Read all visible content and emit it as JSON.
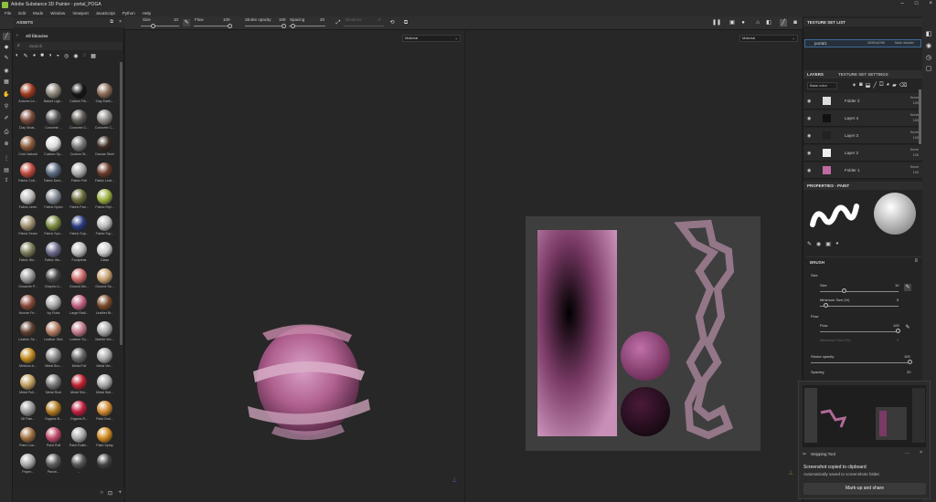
{
  "window": {
    "title": "Adobe Substance 3D Painter - portal_POGA"
  },
  "menu": [
    "File",
    "Edit",
    "Mode",
    "Window",
    "Viewport",
    "JavaScript",
    "Python",
    "Help"
  ],
  "toolbar": {
    "size_label": "Size",
    "size_value": "10",
    "flow_label": "Flow",
    "flow_value": "100",
    "stroke_label": "Stroke opacity",
    "stroke_value": "100",
    "spacing_label": "Spacing",
    "spacing_value": "20",
    "distance_label": "Distance",
    "distance_value": "0"
  },
  "assets": {
    "title": "ASSETS",
    "library": "All libraries",
    "search_placeholder": "Search",
    "items": [
      "Autumn Le...",
      "Baked Ligh...",
      "Carbon Fib...",
      "Clay Earth...",
      "Clay Smal...",
      "Concrete ...",
      "Concrete C...",
      "Concrete C...",
      "Cork Natural",
      "Custom Sp...",
      "Custom St...",
      "Damas Steel",
      "Fabric Cott...",
      "Fabric Deni...",
      "Fabric Felt",
      "Fabric Leat...",
      "Fabric Linen",
      "Fabric Nylon",
      "Fabric Pan...",
      "Fabric Ripl...",
      "Fabric Seam",
      "Fabric Spo...",
      "Fabric Sup...",
      "Fabric Top...",
      "Fabric Wo...",
      "Fabric Wo...",
      "Footprints",
      "Glass",
      "Gouache P...",
      "Graphic Li...",
      "Ground Mo...",
      "Ground Sa...",
      "Human Fe...",
      "Ivy Rubs",
      "Large Radi...",
      "Leather Br...",
      "Leather Se...",
      "Leather Skin",
      "Leather Su...",
      "Marble Wo...",
      "Medium A...",
      "Metal Bro...",
      "Metal Foil",
      "Metal Ver...",
      "Metal Poli...",
      "Metal Rust",
      "Metal Sim...",
      "Metal Wal...",
      "Oil Pain...",
      "Organic B...",
      "Organic R...",
      "Paint Drol...",
      "Paint Coa...",
      "Paint Roll",
      "Paint Rollin...",
      "Paint Spray",
      "Paper...",
      "Parcel...",
      "...",
      ""
    ],
    "colors": [
      "#a03a1f",
      "#8a8478",
      "#151515",
      "#8a6a55",
      "#7a4a3a",
      "#555",
      "#5e5a55",
      "#8d8985",
      "#8a5a3a",
      "#ddd",
      "#777",
      "#3a2a22",
      "#c04a3c",
      "#5a6a80",
      "#aaa",
      "#6a3a2a",
      "#bbb",
      "#808890",
      "#6a6a3a",
      "#9ab040",
      "#a09070",
      "#7a8a40",
      "#2a3a80",
      "#bbb",
      "#7a7a5a",
      "#6a6a8a",
      "#bbb",
      "#ccc",
      "#999",
      "#444",
      "#cc6a6a",
      "#c8a070",
      "#8a4a3a",
      "#aaa",
      "#c06080",
      "#7a4a2a",
      "#604030",
      "#b07a60",
      "#c07a8a",
      "#aaa",
      "#c08a20",
      "#888",
      "#666",
      "#aaa",
      "#c0a060",
      "#777",
      "#c02030",
      "#aaa",
      "#999",
      "#b07a20",
      "#c02040",
      "#d08a30",
      "#a07040",
      "#c04a6a",
      "#aaa",
      "#d08a20",
      "#aaa",
      "#5a5a5a",
      "#555",
      "#444"
    ]
  },
  "viewport": {
    "left_mode": "Material",
    "right_mode": "Material"
  },
  "texture_set": {
    "title": "TEXTURE SET LIST",
    "name": "portal1",
    "res": "4096x4096",
    "shader": "Main shader"
  },
  "layers": {
    "tab1": "LAYERS",
    "tab2": "TEXTURE SET SETTINGS",
    "channel": "Base color",
    "items": [
      {
        "name": "Folder 2",
        "blend": "Norm",
        "op": "100"
      },
      {
        "name": "Layer 4",
        "blend": "Norm",
        "op": "100"
      },
      {
        "name": "Layer 3",
        "blend": "Norm",
        "op": "100"
      },
      {
        "name": "Layer 2",
        "blend": "Norm",
        "op": "100"
      },
      {
        "name": "Folder 1",
        "blend": "Norm",
        "op": "100"
      }
    ]
  },
  "properties": {
    "title": "PROPERTIES - PAINT",
    "brush": "BRUSH",
    "size_group": "Size",
    "size": "Size",
    "size_val": "10",
    "min_size": "Minimum Size (%)",
    "min_size_val": "5",
    "flow_group": "Flow",
    "flow": "Flow",
    "flow_val": "100",
    "min_flow": "Minimum Flow (%)",
    "min_flow_val": "0",
    "stroke": "Stroke opacity",
    "stroke_val": "100",
    "spacing": "Spacing",
    "spacing_val": "20"
  },
  "snip": {
    "app": "Snipping Tool",
    "line1": "Screenshot copied to clipboard",
    "line2": "Automatically saved to screenshots folder.",
    "button": "Mark-up and share"
  }
}
